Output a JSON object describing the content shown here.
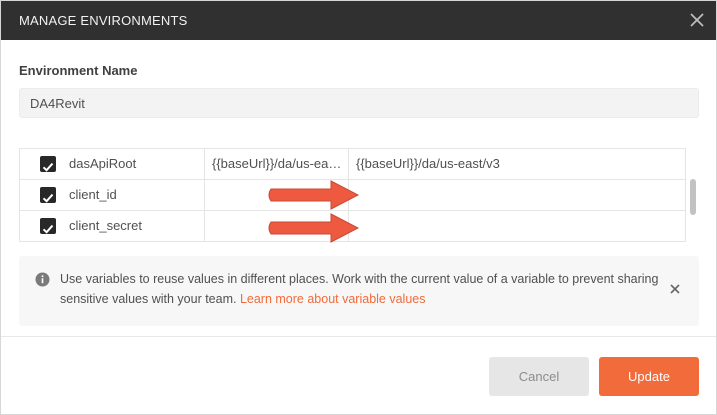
{
  "header": {
    "title": "MANAGE ENVIRONMENTS"
  },
  "form": {
    "env_name_label": "Environment Name",
    "env_name_value": "DA4Revit"
  },
  "variables": [
    {
      "enabled": true,
      "key": "dasApiRoot",
      "initial": "{{baseUrl}}/da/us-ea…",
      "current": "{{baseUrl}}/da/us-east/v3"
    },
    {
      "enabled": true,
      "key": "client_id",
      "initial": "",
      "current": ""
    },
    {
      "enabled": true,
      "key": "client_secret",
      "initial": "",
      "current": ""
    }
  ],
  "info": {
    "text": "Use variables to reuse values in different places. Work with the current value of a variable to prevent sharing sensitive values with your team. ",
    "link": "Learn more about variable values"
  },
  "buttons": {
    "cancel": "Cancel",
    "update": "Update"
  },
  "colors": {
    "accent": "#f26b3a",
    "header_bg": "#303030",
    "checkbox": "#282828"
  },
  "icons": [
    "close-icon",
    "checkbox-checked-icon",
    "info-icon",
    "dismiss-icon",
    "annotation-arrow-icon"
  ]
}
